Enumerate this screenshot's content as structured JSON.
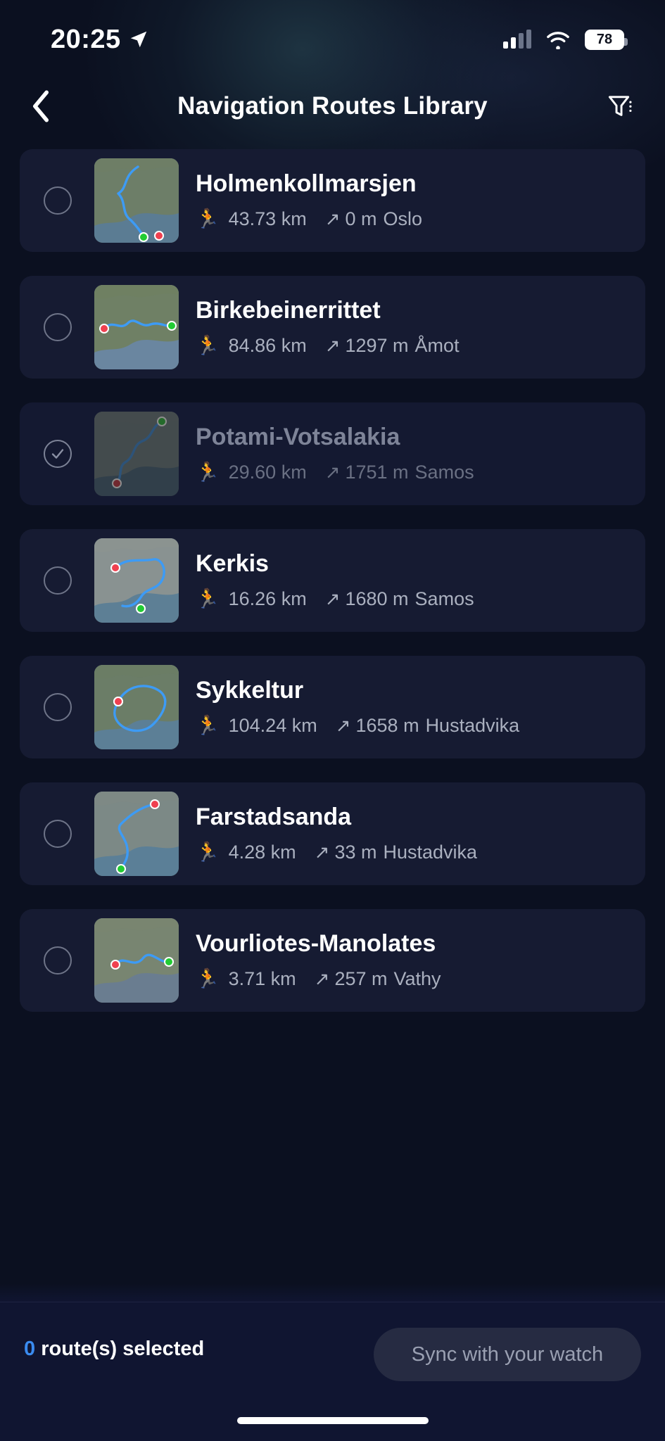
{
  "status_bar": {
    "time": "20:25",
    "location_icon": "location-arrow-icon",
    "signal_icon": "cellular-signal-icon",
    "wifi_icon": "wifi-icon",
    "battery_level": "78"
  },
  "header": {
    "back_icon": "chevron-left-icon",
    "title": "Navigation Routes Library",
    "filter_icon": "filter-icon"
  },
  "routes": [
    {
      "name": "Holmenkollmarsjen",
      "distance": "43.73 km",
      "elevation": "0 m",
      "location": "Oslo",
      "selected": false,
      "activity_icon": "running-icon",
      "elevation_icon": "arrow-up-right-icon"
    },
    {
      "name": "Birkebeinerrittet",
      "distance": "84.86 km",
      "elevation": "1297 m",
      "location": "Åmot",
      "selected": false,
      "activity_icon": "running-icon",
      "elevation_icon": "arrow-up-right-icon"
    },
    {
      "name": "Potami-Votsalakia",
      "distance": "29.60 km",
      "elevation": "1751 m",
      "location": "Samos",
      "selected": true,
      "activity_icon": "running-icon",
      "elevation_icon": "arrow-up-right-icon"
    },
    {
      "name": "Kerkis",
      "distance": "16.26 km",
      "elevation": "1680 m",
      "location": "Samos",
      "selected": false,
      "activity_icon": "running-icon",
      "elevation_icon": "arrow-up-right-icon"
    },
    {
      "name": "Sykkeltur",
      "distance": "104.24 km",
      "elevation": "1658 m",
      "location": "Hustadvika",
      "selected": false,
      "activity_icon": "running-icon",
      "elevation_icon": "arrow-up-right-icon"
    },
    {
      "name": "Farstadsanda",
      "distance": "4.28 km",
      "elevation": "33 m",
      "location": "Hustadvika",
      "selected": false,
      "activity_icon": "running-icon",
      "elevation_icon": "arrow-up-right-icon"
    },
    {
      "name": "Vourliotes-Manolates",
      "distance": "3.71 km",
      "elevation": "257 m",
      "location": "Vathy",
      "selected": false,
      "activity_icon": "running-icon",
      "elevation_icon": "arrow-up-right-icon"
    }
  ],
  "bottom_bar": {
    "selected_count": "0",
    "selected_label": "route(s) selected",
    "sync_button_label": "Sync with your watch"
  },
  "colors": {
    "page_background": "#0b1020",
    "card_background": "#161b32",
    "accent_blue": "#3a8bf0",
    "route_line": "#3d9bf5",
    "start_marker": "#22cc33",
    "end_marker": "#ef4050",
    "activity_icon": "#e8b024",
    "text_primary": "#ffffff",
    "text_secondary": "#aab0bf",
    "text_dimmed": "#7e8498"
  }
}
